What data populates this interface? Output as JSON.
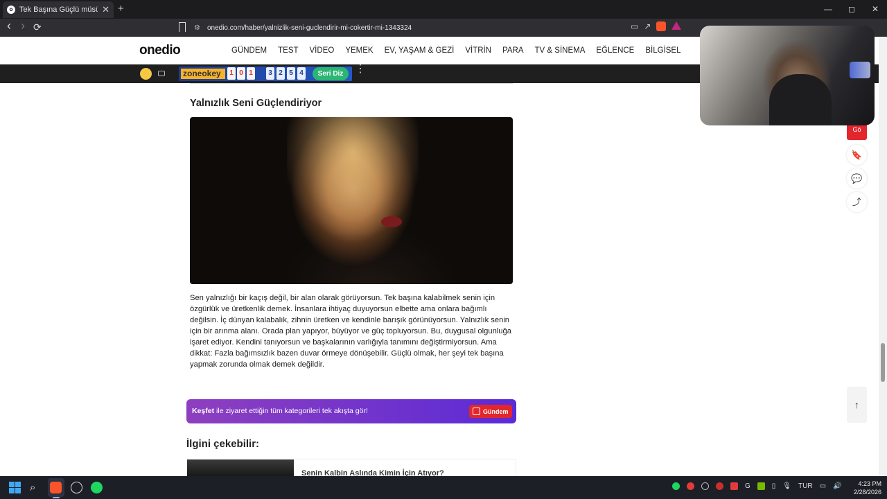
{
  "browser": {
    "tab_title": "Tek Başına Güçlü müsün? - One",
    "tab_close": "✕",
    "new_tab": "+",
    "url": "onedio.com/haber/yalnizlik-seni-guclendirir-mi-cokertir-mi-1343324",
    "win_min": "—",
    "win_max": "◻",
    "win_close": "✕",
    "back": "‹",
    "forward": "›",
    "reload": "⟳"
  },
  "site": {
    "logo": "onedio",
    "nav": [
      "GÜNDEM",
      "TEST",
      "VİDEO",
      "YEMEK",
      "EV, YAŞAM & GEZİ",
      "VİTRİN",
      "PARA",
      "TV & SİNEMA",
      "EĞLENCE",
      "BİLGİSEL"
    ]
  },
  "promo": {
    "zone_label": "zoneokey",
    "tiles": [
      "1",
      "0",
      "1"
    ],
    "tiles2": [
      "3",
      "2",
      "5",
      "4"
    ],
    "cta": "Seri Diz",
    "dots": "•••"
  },
  "article": {
    "title": "Yalnızlık Seni Güçlendiriyor",
    "body": "Sen yalnızlığı bir kaçış değil, bir alan olarak görüyorsun. Tek başına kalabilmek senin için özgürlük ve üretkenlik demek. İnsanlara ihtiyaç duyuyorsun elbette ama onlara bağımlı değilsin. İç dünyan kalabalık, zihnin üretken ve kendinle barışık görünüyorsun. Yalnızlık senin için bir arınma alanı. Orada plan yapıyor, büyüyor ve güç topluyorsun. Bu, duygusal olgunluğa işaret ediyor. Kendini tanıyorsun ve başkalarının varlığıyla tanımını değiştirmiyorsun. Ama dikkat: Fazla bağımsızlık bazen duvar örmeye dönüşebilir. Güçlü olmak, her şeyi tek başına yapmak zorunda olmak demek değildir."
  },
  "kesfet": {
    "bold": "Keşfet",
    "text": " ile ziyaret ettiğin tüm kategorileri tek akışta gör!",
    "pill": "Gündem"
  },
  "related": {
    "heading": "İlgini çekebilir:",
    "item_title": "Senin Kalbin Aslında Kimin İçin Atıyor?"
  },
  "side": {
    "red_label": "Gö",
    "bookmark": "🔖",
    "comments": "💬",
    "share": "⤴",
    "to_top": "↑"
  },
  "taskbar": {
    "search": "⌕",
    "lang": "TUR",
    "time": "4:23 PM",
    "date": "2/28/2026"
  }
}
